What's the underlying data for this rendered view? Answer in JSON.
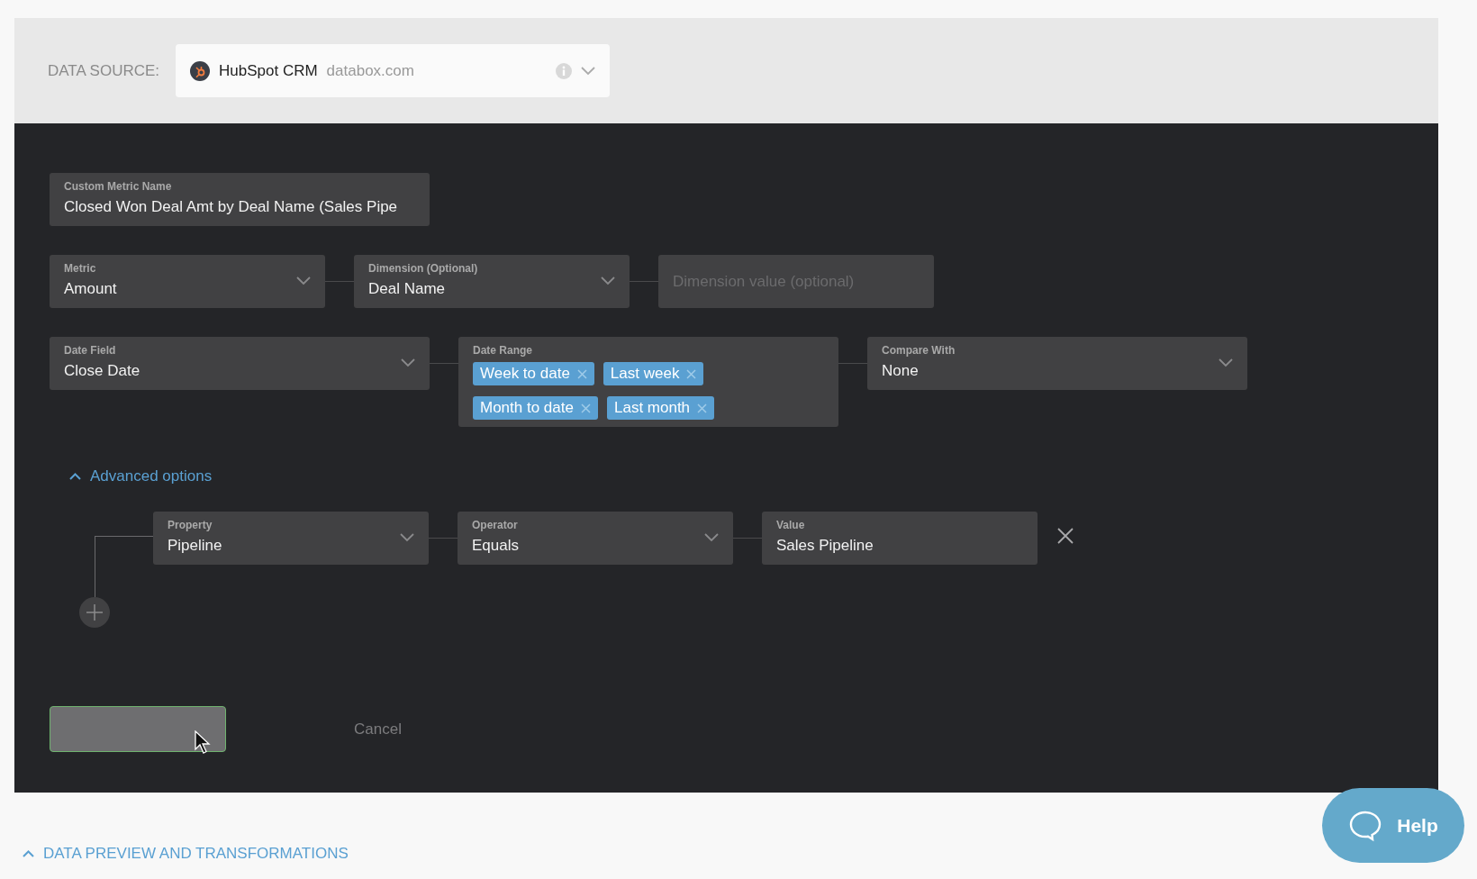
{
  "data_source": {
    "label": "DATA SOURCE:",
    "name": "HubSpot CRM",
    "account": "databox.com"
  },
  "metric_name": {
    "label": "Custom Metric Name",
    "value": "Closed Won Deal Amt by Deal Name (Sales Pipe"
  },
  "row_1": [
    {
      "kind": "select",
      "label": "Metric",
      "value": "Amount"
    },
    {
      "kind": "select",
      "label": "Dimension (Optional)",
      "value": "Deal Name"
    },
    {
      "kind": "input",
      "placeholder": "Dimension value (optional)"
    }
  ],
  "row_2": [
    {
      "kind": "select",
      "label": "Date Field",
      "value": "Close Date"
    },
    {
      "kind": "tags",
      "label": "Date Range",
      "tags": [
        "Week to date",
        "Last week",
        "Month to date",
        "Last month"
      ]
    },
    {
      "kind": "select",
      "label": "Compare With",
      "value": "None"
    }
  ],
  "advanced_options": {
    "label": "Advanced options",
    "expanded": true
  },
  "filter": [
    {
      "kind": "select",
      "label": "Property",
      "value": "Pipeline"
    },
    {
      "kind": "select",
      "label": "Operator",
      "value": "Equals"
    },
    {
      "kind": "text",
      "label": "Value",
      "value": "Sales Pipeline"
    }
  ],
  "cancel": "Cancel",
  "preview": {
    "label": "DATA PREVIEW AND TRANSFORMATIONS",
    "expanded": true
  },
  "help": "Help"
}
